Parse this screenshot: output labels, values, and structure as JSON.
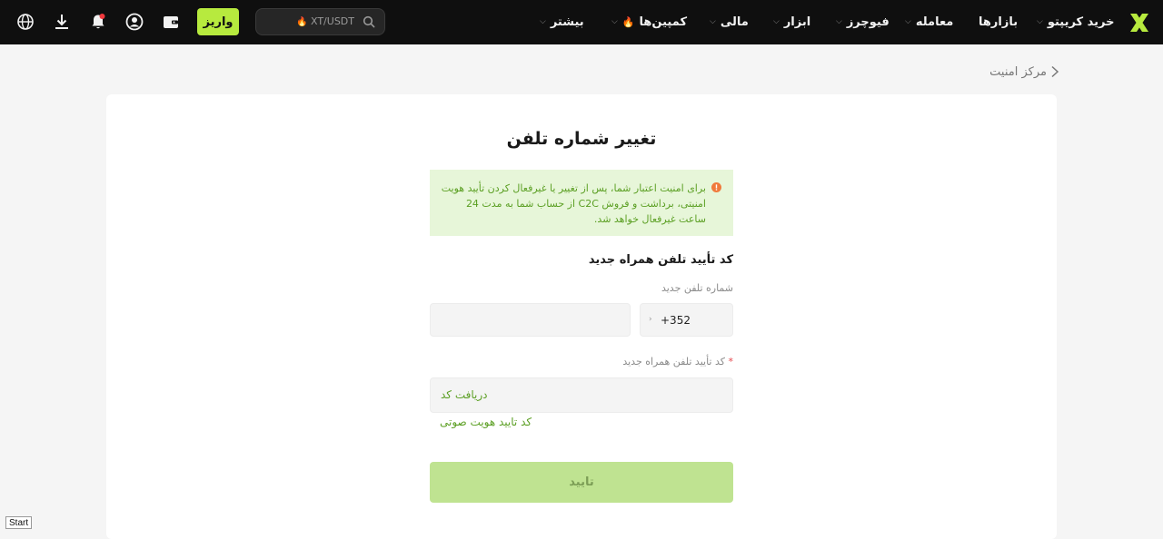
{
  "nav": {
    "items": [
      {
        "label": "خرید کریپتو",
        "dropdown": true,
        "hot": false
      },
      {
        "label": "بازارها",
        "dropdown": false,
        "hot": false
      },
      {
        "label": "معامله",
        "dropdown": true,
        "hot": false
      },
      {
        "label": "فیوچرز",
        "dropdown": true,
        "hot": false
      },
      {
        "label": "ابزار",
        "dropdown": true,
        "hot": false
      },
      {
        "label": "مالی",
        "dropdown": true,
        "hot": false
      },
      {
        "label": "کمپین‌ها",
        "dropdown": true,
        "hot": true
      },
      {
        "label": "بیشتر",
        "dropdown": true,
        "hot": false
      }
    ],
    "search_placeholder": "XT/USDT",
    "deposit_label": "واریز",
    "icons": [
      "wallet-icon",
      "user-icon",
      "bell-icon",
      "download-icon",
      "globe-icon"
    ],
    "accent_color": "#b7ea3e"
  },
  "breadcrumb": {
    "label": "مرکز امنیت"
  },
  "page": {
    "title": "تغییر شماره تلفن",
    "notice": "برای امنیت اعتبار شما، پس از تغییر یا غیرفعال کردن تأیید هویت امنیتی، برداشت و فروش C2C از حساب شما به مدت 24 ساعت غیرفعال خواهد شد.",
    "section_title": "کد تأیید تلفن همراه جدید",
    "phone_label": "شماره تلفن جدید",
    "country_code": "+352",
    "code_label": "کد تأیید تلفن همراه جدید",
    "required_mark": "*",
    "get_code": "دریافت کد",
    "voice_code": "کد تایید هویت صوتی",
    "confirm": "تایید"
  },
  "taskbar": {
    "start": "Start"
  }
}
